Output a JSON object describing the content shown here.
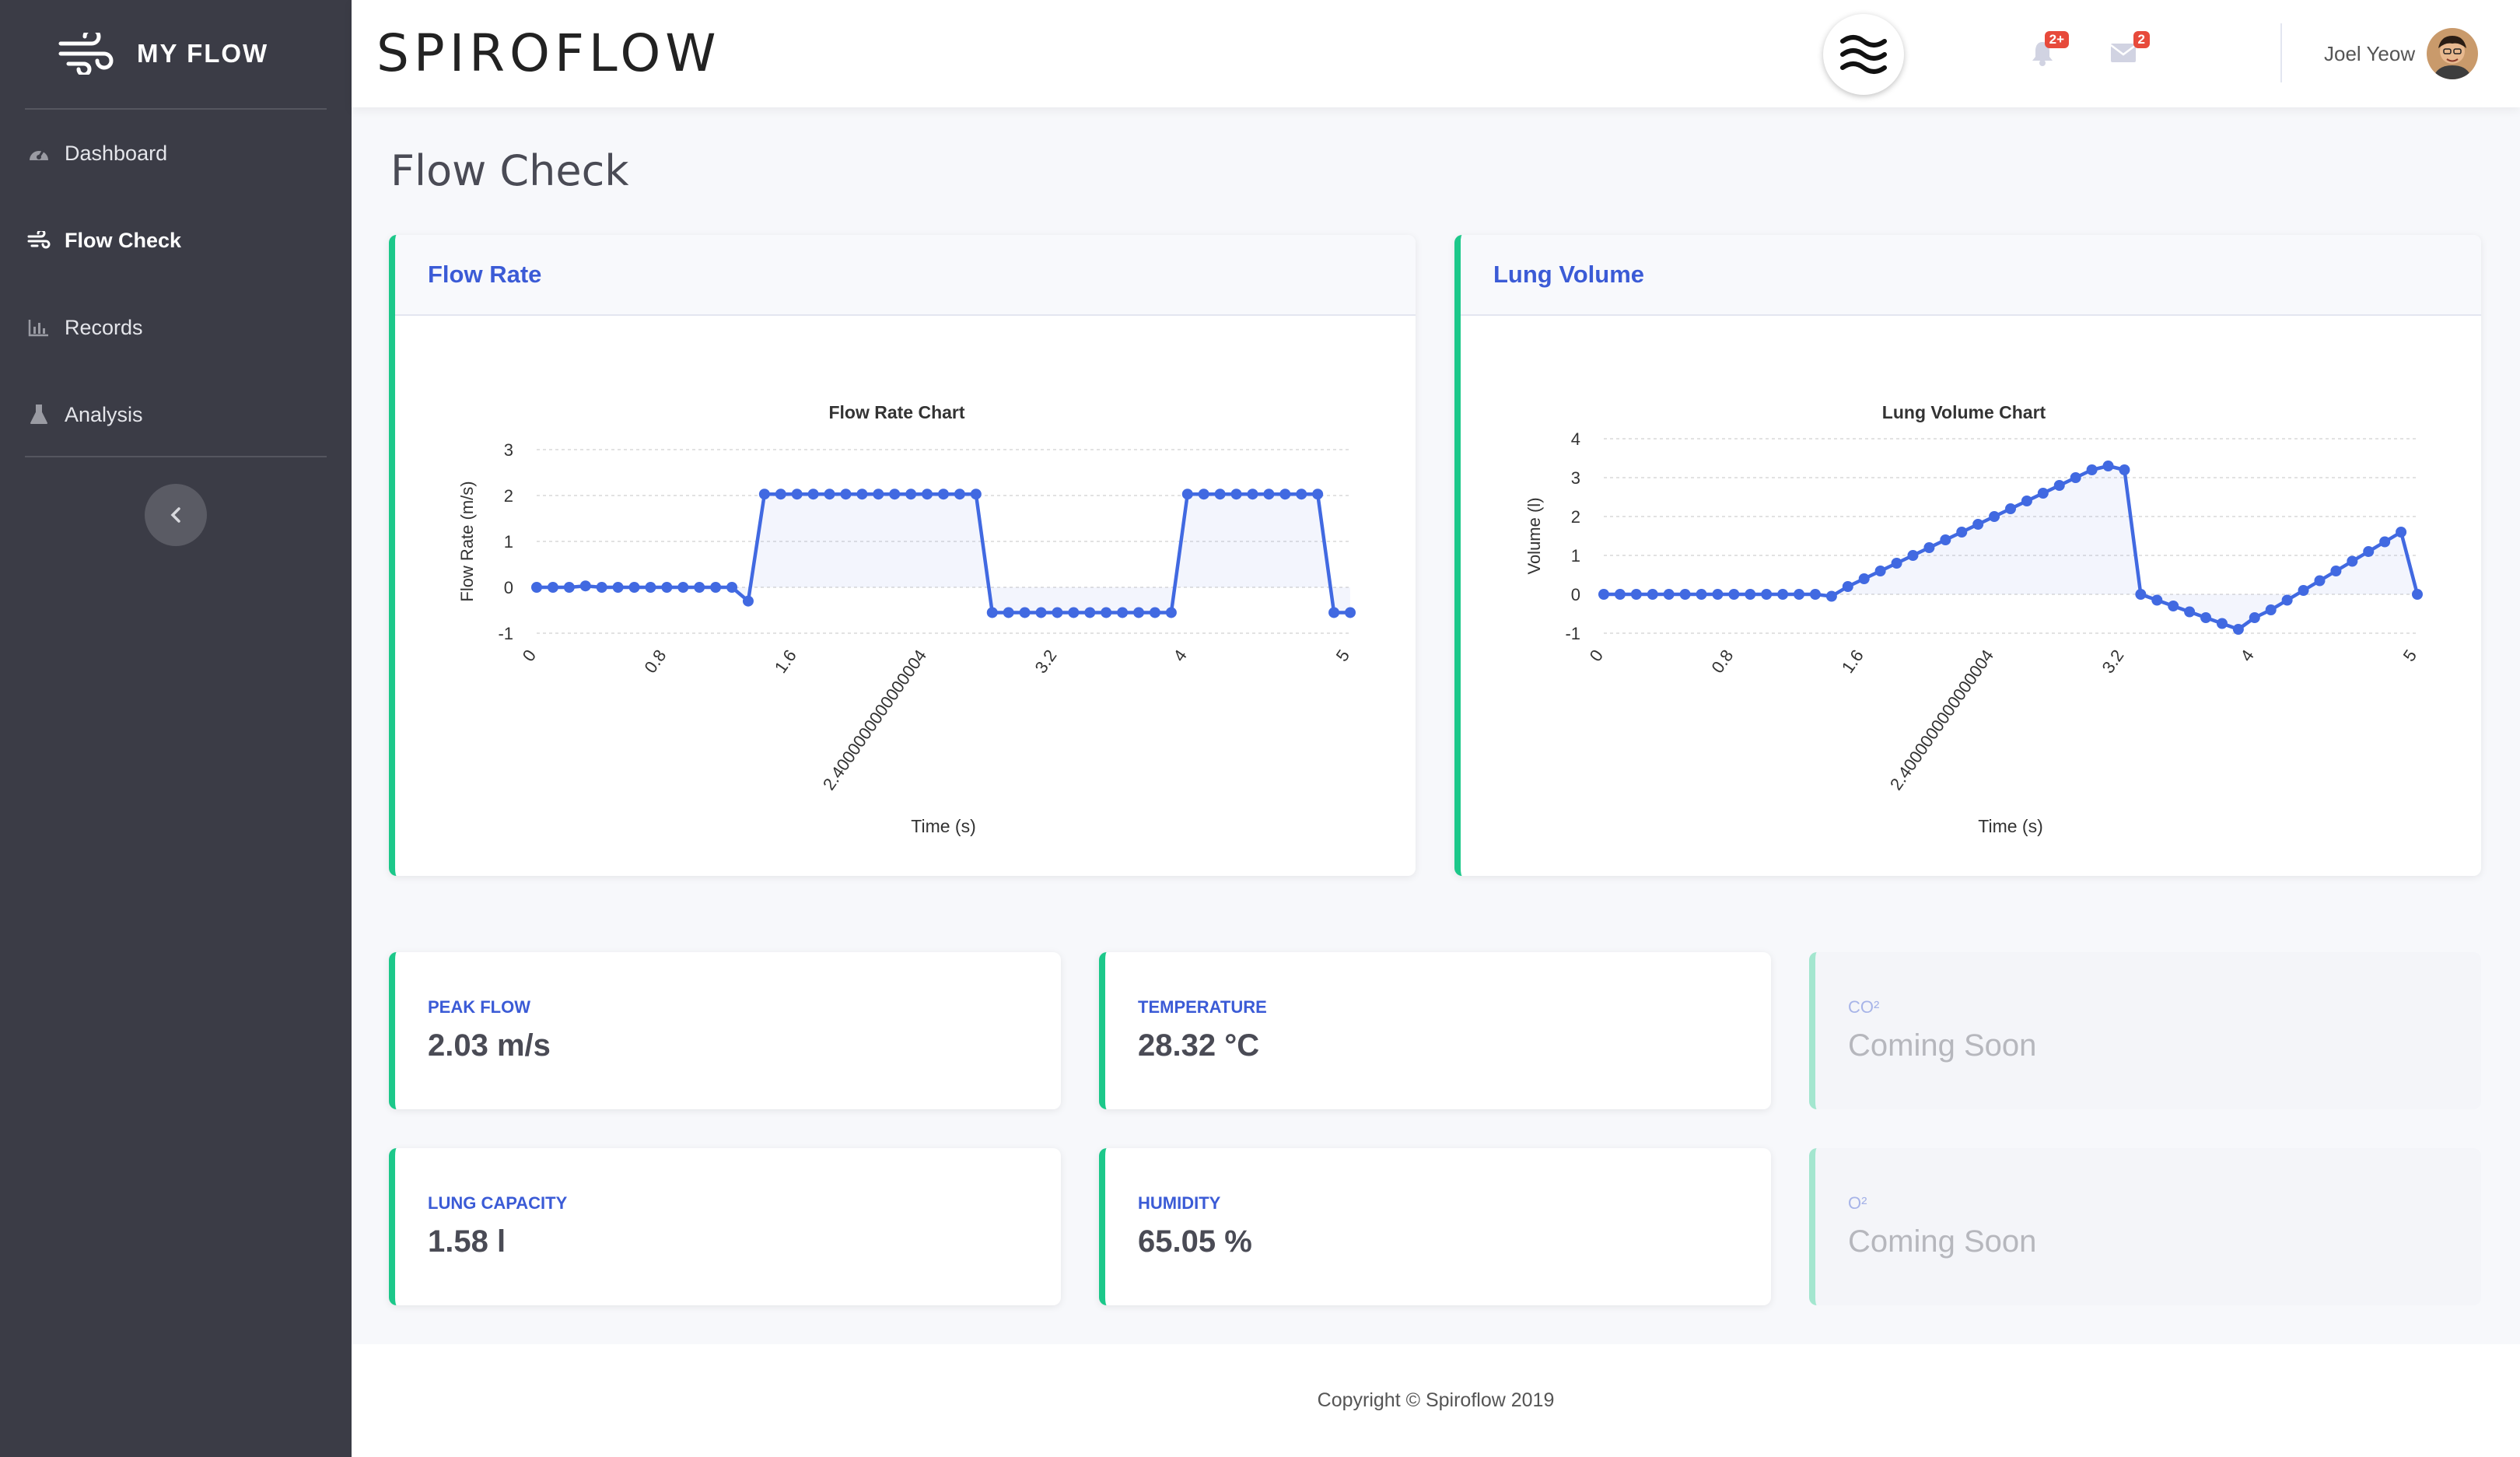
{
  "sidebar": {
    "brand": "MY FLOW",
    "items": [
      {
        "label": "Dashboard",
        "icon": "gauge-icon"
      },
      {
        "label": "Flow Check",
        "icon": "wind-icon"
      },
      {
        "label": "Records",
        "icon": "bar-chart-icon"
      },
      {
        "label": "Analysis",
        "icon": "flask-icon"
      }
    ],
    "active": "Flow Check"
  },
  "topbar": {
    "title": "SPIROFLOW",
    "alerts_badge": "2+",
    "messages_badge": "2",
    "user_name": "Joel Yeow"
  },
  "page": {
    "title": "Flow Check"
  },
  "cards": {
    "flow_rate_header": "Flow Rate",
    "lung_volume_header": "Lung Volume"
  },
  "stats": {
    "peak_flow": {
      "label": "Peak Flow",
      "value": "2.03 m/s"
    },
    "temperature": {
      "label": "Temperature",
      "value": "28.32 °C"
    },
    "co2": {
      "label": "CO²",
      "value": "Coming Soon"
    },
    "lung_capacity": {
      "label": "Lung Capacity",
      "value": "1.58 l"
    },
    "humidity": {
      "label": "Humidity",
      "value": "65.05 %"
    },
    "o2": {
      "label": "O²",
      "value": "Coming Soon"
    }
  },
  "footer": {
    "copyright": "Copyright © Spiroflow 2019"
  },
  "colors": {
    "accent": "#1cc88a",
    "primary": "#3b5bd6",
    "sidebar": "#3b3c46",
    "line": "#4169e1",
    "badge": "#e74a3b"
  },
  "chart_data": [
    {
      "type": "line",
      "title": "Flow Rate Chart",
      "xlabel": "Time (s)",
      "ylabel": "Flow Rate (m/s)",
      "ylim": [
        -1,
        3
      ],
      "yticks": [
        3,
        2,
        1,
        0,
        -1
      ],
      "xticks": [
        {
          "x": 0,
          "label": "0"
        },
        {
          "x": 0.8,
          "label": "0.8"
        },
        {
          "x": 1.6,
          "label": "1.6"
        },
        {
          "x": 2.4,
          "label": "2.4000000000000004"
        },
        {
          "x": 3.2,
          "label": "3.2"
        },
        {
          "x": 4,
          "label": "4"
        },
        {
          "x": 5,
          "label": "5"
        }
      ],
      "grid": true,
      "series": [
        {
          "x": [
            0,
            0.1,
            0.2,
            0.3,
            0.4,
            0.5,
            0.6,
            0.7,
            0.8,
            0.9,
            1.0,
            1.1,
            1.2,
            1.3,
            1.4,
            1.5,
            1.6,
            1.7,
            1.8,
            1.9,
            2.0,
            2.1,
            2.2,
            2.3,
            2.4,
            2.5,
            2.6,
            2.7,
            2.8,
            2.9,
            3.0,
            3.1,
            3.2,
            3.3,
            3.4,
            3.5,
            3.6,
            3.7,
            3.8,
            3.9,
            4.0,
            4.1,
            4.2,
            4.3,
            4.4,
            4.5,
            4.6,
            4.7,
            4.8,
            4.9,
            5.0
          ],
          "values": [
            0,
            0,
            0,
            0.03,
            0,
            0,
            0,
            0,
            0,
            0,
            0,
            0,
            0,
            -0.3,
            2.03,
            2.03,
            2.03,
            2.03,
            2.03,
            2.03,
            2.03,
            2.03,
            2.03,
            2.03,
            2.03,
            2.03,
            2.03,
            2.03,
            -0.55,
            -0.55,
            -0.55,
            -0.55,
            -0.55,
            -0.55,
            -0.55,
            -0.55,
            -0.55,
            -0.55,
            -0.55,
            -0.55,
            2.03,
            2.03,
            2.03,
            2.03,
            2.03,
            2.03,
            2.03,
            2.03,
            2.03,
            -0.55,
            -0.55
          ]
        }
      ]
    },
    {
      "type": "line",
      "title": "Lung Volume Chart",
      "xlabel": "Time (s)",
      "ylabel": "Volume (l)",
      "ylim": [
        -1,
        4
      ],
      "yticks": [
        4,
        3,
        2,
        1,
        0,
        -1
      ],
      "xticks": [
        {
          "x": 0,
          "label": "0"
        },
        {
          "x": 0.8,
          "label": "0.8"
        },
        {
          "x": 1.6,
          "label": "1.6"
        },
        {
          "x": 2.4,
          "label": "2.4000000000000004"
        },
        {
          "x": 3.2,
          "label": "3.2"
        },
        {
          "x": 4,
          "label": "4"
        },
        {
          "x": 5,
          "label": "5"
        }
      ],
      "grid": true,
      "series": [
        {
          "x": [
            0,
            0.1,
            0.2,
            0.3,
            0.4,
            0.5,
            0.6,
            0.7,
            0.8,
            0.9,
            1.0,
            1.1,
            1.2,
            1.3,
            1.4,
            1.5,
            1.6,
            1.7,
            1.8,
            1.9,
            2.0,
            2.1,
            2.2,
            2.3,
            2.4,
            2.5,
            2.6,
            2.7,
            2.8,
            2.9,
            3.0,
            3.1,
            3.2,
            3.3,
            3.4,
            3.5,
            3.6,
            3.7,
            3.8,
            3.9,
            4.0,
            4.1,
            4.2,
            4.3,
            4.4,
            4.5,
            4.6,
            4.7,
            4.8,
            4.9,
            5.0
          ],
          "values": [
            0,
            0,
            0,
            0,
            0,
            0,
            0,
            0,
            0,
            0,
            0,
            0,
            0,
            0,
            -0.05,
            0.2,
            0.4,
            0.6,
            0.8,
            1.0,
            1.2,
            1.4,
            1.6,
            1.8,
            2.0,
            2.2,
            2.4,
            2.6,
            2.8,
            3.0,
            3.2,
            3.3,
            3.2,
            0,
            -0.15,
            -0.3,
            -0.45,
            -0.6,
            -0.75,
            -0.9,
            -0.6,
            -0.4,
            -0.15,
            0.1,
            0.35,
            0.6,
            0.85,
            1.1,
            1.35,
            1.6,
            0
          ]
        }
      ]
    }
  ]
}
